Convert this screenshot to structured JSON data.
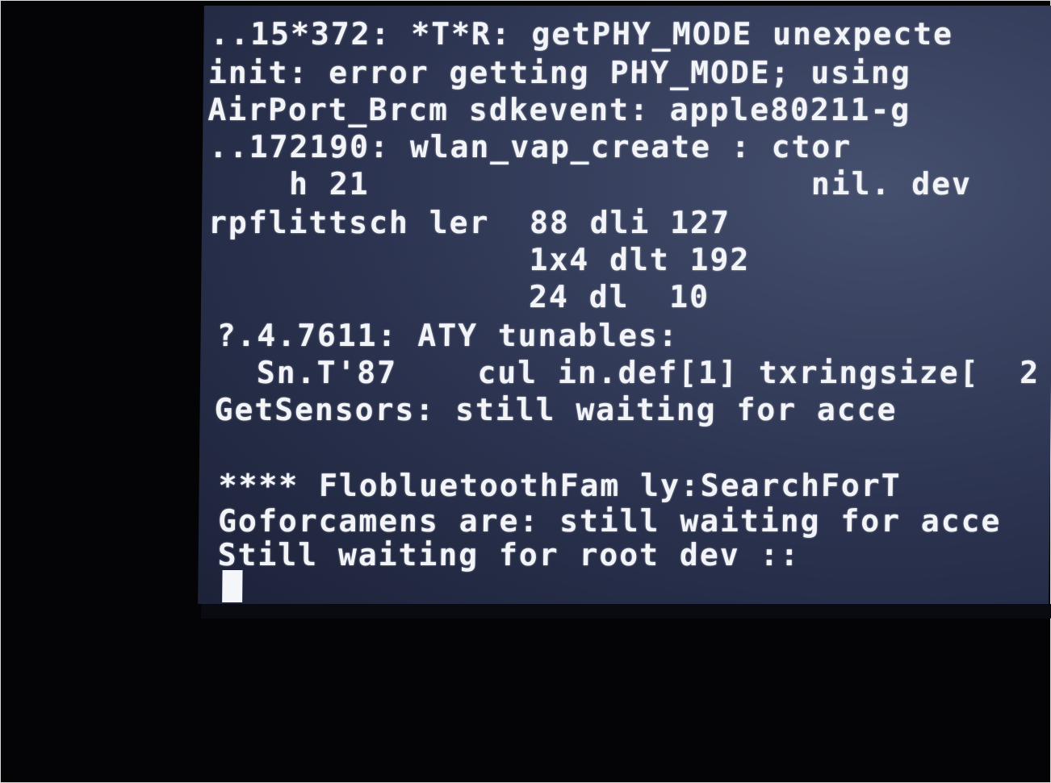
{
  "console": {
    "lines": [
      "..15*372: *T*R: getPHY_MODE unexpecte",
      "init: error getting PHY_MODE; using",
      "AirPort_Brcm sdkevent: apple80211-g",
      "..172190: wlan_vap_create : ctor ",
      "    h 21                      nil. dev",
      "rpflittsch ler  88 dli 127",
      "                1x4 dlt 192",
      "                24 dl  10",
      "?.4.7611: ATY tunables:",
      "  Sn.T'87    cul in.def[1] txringsize[  2",
      "GetSensors: still waiting for acce",
      "",
      "**** FlobluetoothFam ly:SearchForT",
      "Goforcamens are: still waiting for acce",
      "Still waiting for root dev ::"
    ]
  }
}
